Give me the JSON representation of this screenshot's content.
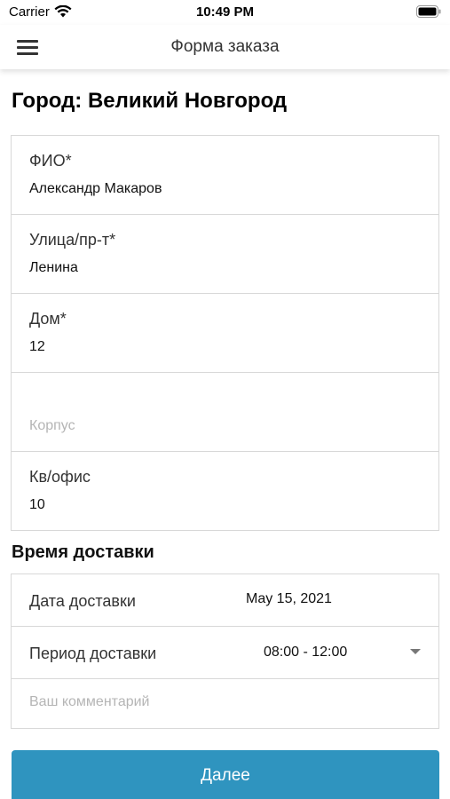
{
  "status_bar": {
    "carrier": "Carrier",
    "time": "10:49 PM"
  },
  "nav": {
    "title": "Форма заказа"
  },
  "city": {
    "title": "Город: Великий Новгород"
  },
  "fields": {
    "fio": {
      "label": "ФИО*",
      "value": "Александр Макаров"
    },
    "street": {
      "label": "Улица/пр-т*",
      "value": "Ленина"
    },
    "house": {
      "label": "Дом*",
      "value": "12"
    },
    "building": {
      "placeholder": "Корпус"
    },
    "apartment": {
      "label": "Кв/офис",
      "value": "10"
    }
  },
  "delivery": {
    "section_title": "Время доставки",
    "date_label": "Дата доставки",
    "date_value": "May 15, 2021",
    "period_label": "Период доставки",
    "period_value": "08:00 - 12:00",
    "comment_placeholder": "Ваш комментарий"
  },
  "next_button": {
    "label": "Далее"
  },
  "colors": {
    "accent": "#2f94bf",
    "border": "#d8d8d8",
    "placeholder": "#b5b5b5"
  }
}
